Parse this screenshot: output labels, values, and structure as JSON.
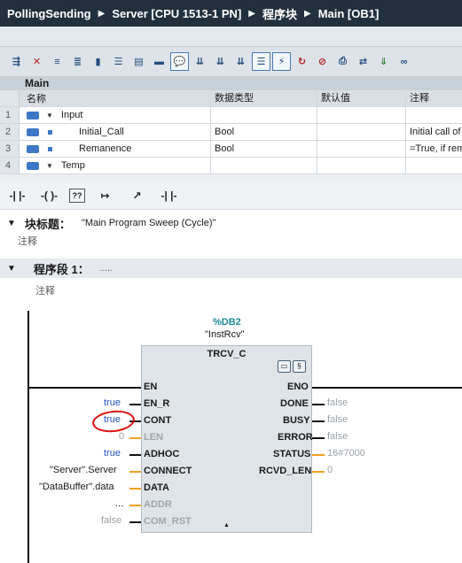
{
  "breadcrumb": {
    "items": [
      "PollingSending",
      "Server [CPU 1513-1 PN]",
      "程序块",
      "Main [OB1]"
    ]
  },
  "block_name": "Main",
  "interface_table": {
    "headers": [
      "名称",
      "数据类型",
      "默认值",
      "注释"
    ],
    "rows": [
      {
        "num": "1",
        "name": "Input",
        "type": "",
        "default": "",
        "comment": "",
        "kind": "section"
      },
      {
        "num": "2",
        "name": "Initial_Call",
        "type": "Bool",
        "default": "",
        "comment": "Initial call of",
        "kind": "var"
      },
      {
        "num": "3",
        "name": "Remanence",
        "type": "Bool",
        "default": "",
        "comment": "=True, if rem",
        "kind": "var"
      },
      {
        "num": "4",
        "name": "Temp",
        "type": "",
        "default": "",
        "comment": "",
        "kind": "section"
      }
    ]
  },
  "ladder_toolbar": [
    "-| |-",
    "-( )-",
    "??",
    "↦",
    "↗",
    "-| |-"
  ],
  "block_title": {
    "label": "块标题：",
    "value": "\"Main Program Sweep (Cycle)\"",
    "comment": "注释"
  },
  "network": {
    "label": "程序段 1：",
    "title": ".....",
    "comment": "注释"
  },
  "fb": {
    "db": "%DB2",
    "instance": "\"InstRcv\"",
    "name": "TRCV_C",
    "inputs": [
      {
        "pin": "EN",
        "value": "",
        "greyed": false
      },
      {
        "pin": "EN_R",
        "value": "true",
        "greyed": false
      },
      {
        "pin": "CONT",
        "value": "true",
        "greyed": false
      },
      {
        "pin": "LEN",
        "value": "0",
        "greyed": true
      },
      {
        "pin": "ADHOC",
        "value": "true",
        "greyed": false
      },
      {
        "pin": "CONNECT",
        "value": "\"Server\".Server",
        "greyed": false
      },
      {
        "pin": "DATA",
        "value": "\"DataBuffer\".data",
        "greyed": false
      },
      {
        "pin": "ADDR",
        "value": "...",
        "greyed": true
      },
      {
        "pin": "COM_RST",
        "value": "false",
        "greyed": true
      }
    ],
    "outputs": [
      {
        "pin": "ENO",
        "value": ""
      },
      {
        "pin": "DONE",
        "value": "false"
      },
      {
        "pin": "BUSY",
        "value": "false"
      },
      {
        "pin": "ERROR",
        "value": "false"
      },
      {
        "pin": "STATUS",
        "value": "16#7000"
      },
      {
        "pin": "RCVD_LEN",
        "value": "0"
      }
    ]
  },
  "colors": {
    "breadcrumb_bg": "#22303d",
    "db_teal": "#1f8a96",
    "bool_true_blue": "#1c55b8",
    "wire_orange": "#f0a020",
    "highlight_red": "#e01010"
  }
}
